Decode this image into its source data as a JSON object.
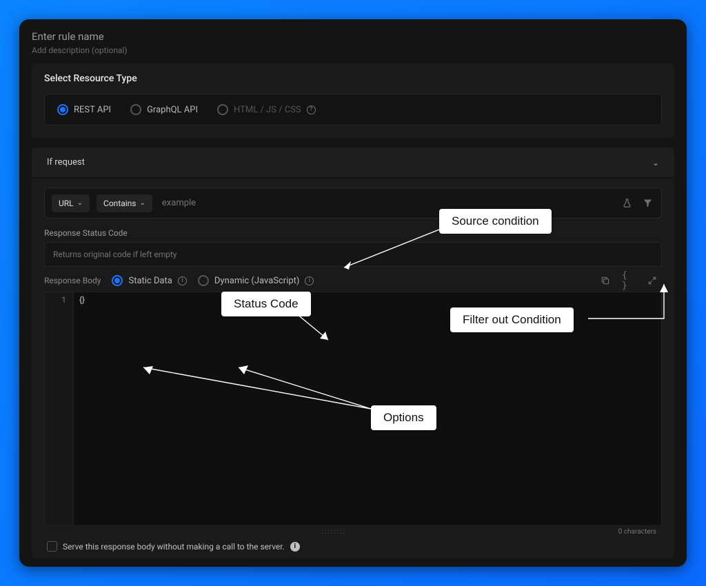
{
  "header": {
    "rule_name_placeholder": "Enter rule name",
    "rule_desc_placeholder": "Add description (optional)"
  },
  "resource": {
    "title": "Select Resource Type",
    "options": {
      "rest": "REST API",
      "graphql": "GraphQL API",
      "html": "HTML / JS / CSS"
    }
  },
  "request": {
    "title": "If request",
    "url_sel": "URL",
    "match_sel": "Contains",
    "match_placeholder": "example"
  },
  "status": {
    "label": "Response Status Code",
    "placeholder": "Returns original code if left empty"
  },
  "body": {
    "label": "Response Body",
    "static_opt": "Static Data",
    "dynamic_opt": "Dynamic (JavaScript)",
    "line_no": "1",
    "code": "{}",
    "char_count": "0 characters",
    "handle": "::::::::"
  },
  "serve": {
    "label": "Serve this response body without making a call to the server."
  },
  "annotations": {
    "source": "Source condition",
    "status": "Status Code",
    "filter": "Filter out Condition",
    "options": "Options"
  }
}
